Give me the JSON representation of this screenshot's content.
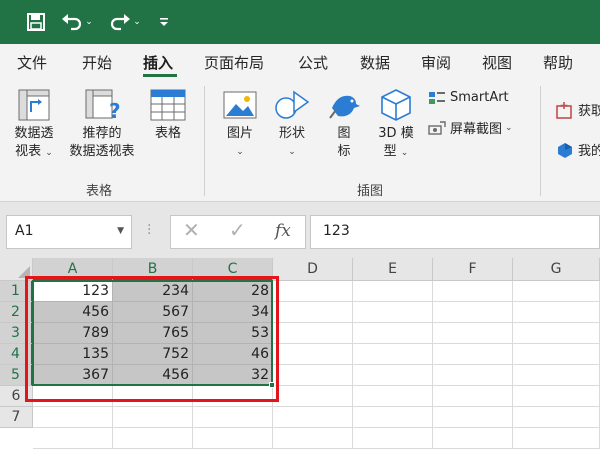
{
  "colors": {
    "accent": "#217346",
    "highlight": "#e3151a"
  },
  "quick_access": {
    "icons": [
      "save-icon",
      "undo-icon",
      "redo-icon",
      "customize-icon"
    ]
  },
  "tabs": [
    "文件",
    "开始",
    "插入",
    "页面布局",
    "公式",
    "数据",
    "审阅",
    "视图",
    "帮助"
  ],
  "active_tab": "插入",
  "ribbon": {
    "tables_group": {
      "label": "表格",
      "pivot_line1": "数据透",
      "pivot_line2": "视表",
      "recommended_line1": "推荐的",
      "recommended_line2": "数据透视表",
      "table": "表格"
    },
    "illustrations_group": {
      "label": "插图",
      "pictures": "图片",
      "shapes": "形状",
      "icons_line1": "图",
      "icons_line2": "标",
      "models_line1": "3D 模",
      "models_line2": "型",
      "smartart": "SmartArt",
      "screenshot": "屏幕截图"
    },
    "addins_group": {
      "get_addins": "获取",
      "my_addins": "我的"
    }
  },
  "formula_bar": {
    "name_box": "A1",
    "fx": "fx",
    "value": "123"
  },
  "grid": {
    "columns": [
      "A",
      "B",
      "C",
      "D",
      "E",
      "F",
      "G"
    ],
    "rows": [
      "1",
      "2",
      "3",
      "4",
      "5",
      "6",
      "7"
    ],
    "data": [
      [
        "123",
        "234",
        "28"
      ],
      [
        "456",
        "567",
        "34"
      ],
      [
        "789",
        "765",
        "53"
      ],
      [
        "135",
        "752",
        "46"
      ],
      [
        "367",
        "456",
        "32"
      ]
    ]
  }
}
